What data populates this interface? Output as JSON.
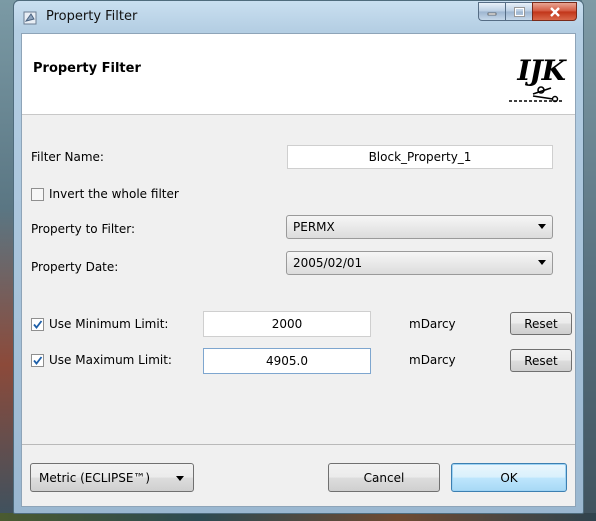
{
  "window": {
    "title": "Property Filter",
    "controls": {
      "minimize": "—",
      "maximize": "□",
      "close": "X"
    }
  },
  "header": {
    "title": "Property Filter",
    "logo_text": "IJK"
  },
  "form": {
    "filter_name_label": "Filter Name:",
    "filter_name_value": "Block_Property_1",
    "invert_label": "Invert the whole filter",
    "invert_checked": false,
    "property_label": "Property to Filter:",
    "property_value": "PERMX",
    "date_label": "Property Date:",
    "date_value": "2005/02/01",
    "min": {
      "label": "Use Minimum Limit:",
      "checked": true,
      "value": "2000",
      "unit": "mDarcy",
      "reset_label": "Reset"
    },
    "max": {
      "label": "Use Maximum Limit:",
      "checked": true,
      "value": "4905.0",
      "unit": "mDarcy",
      "reset_label": "Reset"
    }
  },
  "footer": {
    "unit_system": "Metric (ECLIPSE™)",
    "cancel_label": "Cancel",
    "ok_label": "OK"
  },
  "colors": {
    "accent": "#3c7fb1",
    "close": "#c13418",
    "check": "#1e5fa8"
  },
  "icons": [
    "app-icon",
    "minimize-icon",
    "maximize-icon",
    "close-icon",
    "checkmark-icon",
    "chevron-down-icon",
    "scissors-icon"
  ]
}
